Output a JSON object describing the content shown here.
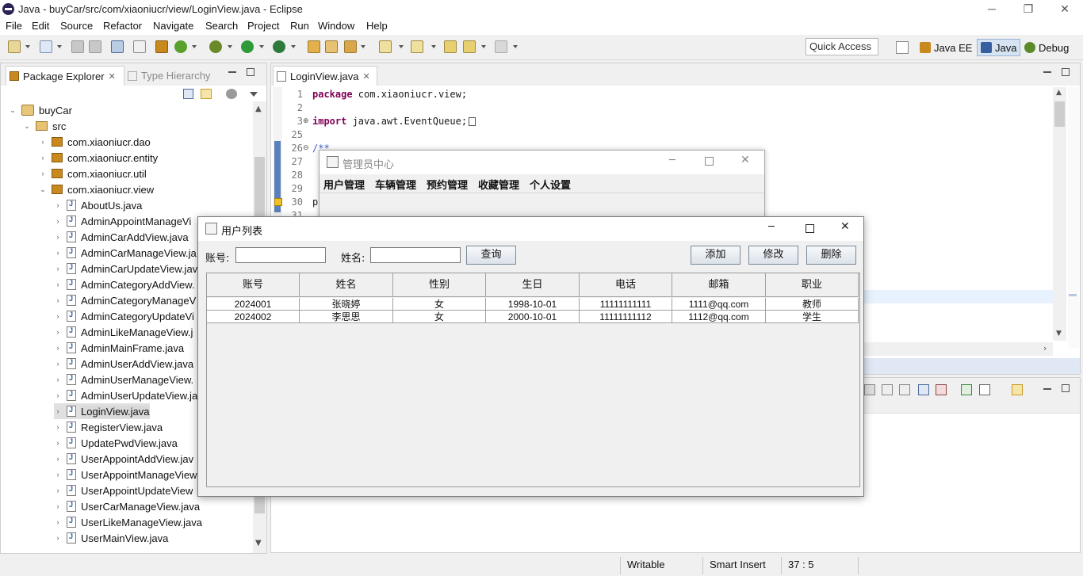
{
  "window": {
    "title": "Java - buyCar/src/com/xiaoniucr/view/LoginView.java - Eclipse"
  },
  "menu": [
    "File",
    "Edit",
    "Source",
    "Refactor",
    "Navigate",
    "Search",
    "Project",
    "Run",
    "Window",
    "Help"
  ],
  "toolbar": {
    "quick_access": "Quick Access",
    "perspectives": [
      "Java EE",
      "Java",
      "Debug"
    ]
  },
  "package_explorer": {
    "tabs": [
      "Package Explorer",
      "Type Hierarchy"
    ],
    "project": "buyCar",
    "src": "src",
    "packages": [
      "com.xiaoniucr.dao",
      "com.xiaoniucr.entity",
      "com.xiaoniucr.util",
      "com.xiaoniucr.view"
    ],
    "files": [
      "AboutUs.java",
      "AdminAppointManageVi",
      "AdminCarAddView.java",
      "AdminCarManageView.ja",
      "AdminCarUpdateView.jav",
      "AdminCategoryAddView.",
      "AdminCategoryManageV",
      "AdminCategoryUpdateVi",
      "AdminLikeManageView.j",
      "AdminMainFrame.java",
      "AdminUserAddView.java",
      "AdminUserManageView.",
      "AdminUserUpdateView.ja",
      "LoginView.java",
      "RegisterView.java",
      "UpdatePwdView.java",
      "UserAppointAddView.jav",
      "UserAppointManageView",
      "UserAppointUpdateView",
      "UserCarManageView.java",
      "UserLikeManageView.java",
      "UserMainView.java"
    ]
  },
  "editor": {
    "tab": "LoginView.java",
    "lines": [
      {
        "n": "1",
        "kw": "package",
        "rest": " com.xiaoniucr.view;"
      },
      {
        "n": "2",
        "kw": "",
        "rest": ""
      },
      {
        "n": "3",
        "kw": "import",
        "rest": " java.awt.EventQueue;"
      },
      {
        "n": "25",
        "kw": "",
        "rest": ""
      },
      {
        "n": "26",
        "kw": "",
        "rest": "/**"
      },
      {
        "n": "27",
        "kw": "",
        "rest": ""
      },
      {
        "n": "28",
        "kw": "",
        "rest": ""
      },
      {
        "n": "29",
        "kw": "",
        "rest": ""
      },
      {
        "n": "30",
        "kw": "",
        "rest": "p"
      },
      {
        "n": "31",
        "kw": "",
        "rest": ""
      }
    ]
  },
  "status": {
    "writable": "Writable",
    "insert": "Smart Insert",
    "position": "37 : 5"
  },
  "admin_window": {
    "title": "管理员中心",
    "menu": [
      "用户管理",
      "车辆管理",
      "预约管理",
      "收藏管理",
      "个人设置"
    ]
  },
  "user_list": {
    "title": "用户列表",
    "account_label": "账号:",
    "name_label": "姓名:",
    "query": "查询",
    "add": "添加",
    "edit": "修改",
    "delete": "删除",
    "columns": [
      "账号",
      "姓名",
      "性别",
      "生日",
      "电话",
      "邮箱",
      "职业"
    ],
    "rows": [
      [
        "2024001",
        "张晓婷",
        "女",
        "1998-10-01",
        "11111111111",
        "1111@qq.com",
        "教师"
      ],
      [
        "2024002",
        "李思思",
        "女",
        "2000-10-01",
        "11111111112",
        "1112@qq.com",
        "学生"
      ]
    ]
  }
}
